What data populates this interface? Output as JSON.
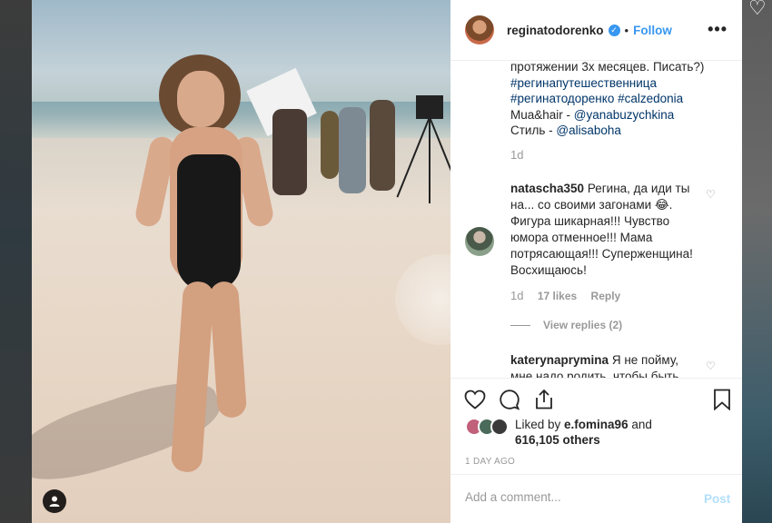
{
  "post": {
    "username": "reginatodorenko",
    "follow_label": "Follow",
    "dot": "•",
    "more_label": "•••"
  },
  "caption": {
    "line1": "протяжении 3х месяцев. Писать?)",
    "tags": [
      "#регинапутешественница",
      "#регинатодоренко",
      "#calzedonia"
    ],
    "mua_prefix": "Mua&hair - ",
    "mua_handle": "@yanabuzychkina",
    "style_prefix": "Стиль - ",
    "style_handle": "@alisaboha",
    "time": "1d"
  },
  "comments": [
    {
      "user": "natascha350",
      "text": "Регина, да иди ты на... со своими загонами 😂. Фигура шикарная!!! Чувство юмора отменное!!! Мама потрясающая!!! Суперженщина! Восхищаюсь!",
      "time": "1d",
      "likes": "17 likes",
      "reply": "Reply",
      "view_replies": "View replies (2)"
    },
    {
      "user": "katerynaprymina",
      "text": "Я не пойму, мне надо родить, чтобы быть"
    }
  ],
  "actions": {
    "liked_by_prefix": "Liked by ",
    "liked_by_user": "e.fomina96",
    "liked_by_suffix": " and",
    "others": "616,105 others",
    "post_time": "1 DAY AGO"
  },
  "add_comment": {
    "placeholder": "Add a comment...",
    "post_label": "Post"
  },
  "colors": {
    "accent": "#3897f0",
    "hashtag": "#003569",
    "muted": "#999999",
    "post_disabled": "#b2dffc"
  }
}
